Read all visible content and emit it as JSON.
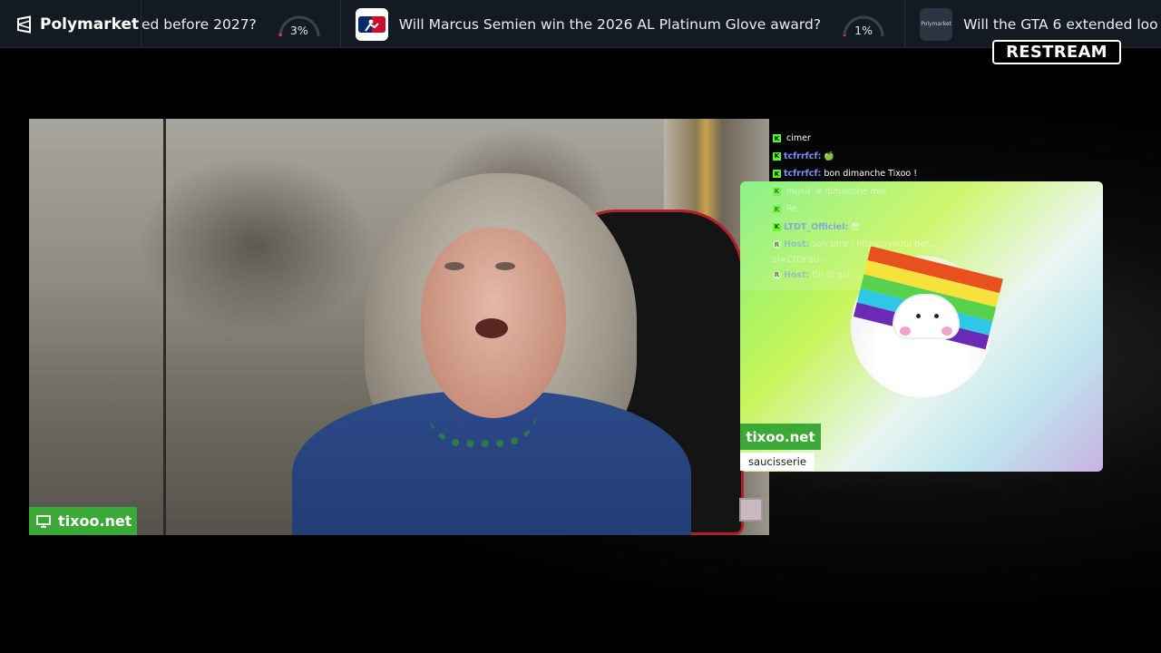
{
  "ticker": {
    "brand": "Polymarket",
    "markets": [
      {
        "question": "ed before 2027?",
        "percent_label": "3%",
        "percent": 3
      },
      {
        "question": "Will Marcus Semien win the 2026 AL Platinum Glove award?",
        "percent_label": "1%",
        "percent": 1
      },
      {
        "question": "Will the GTA 6 extended loo",
        "percent_label": "",
        "percent": null
      }
    ],
    "logo_labels": {
      "polymarket_small": "Polymarket"
    }
  },
  "restream": {
    "logo_text": "RESTREAM"
  },
  "camera": {
    "tag_label": "tixoo.net"
  },
  "chat": {
    "messages": [
      {
        "platform": "kick",
        "user": "",
        "text": "cimer"
      },
      {
        "platform": "kick",
        "user": "tcfrrfcf:",
        "text": "🍏"
      },
      {
        "platform": "kick",
        "user": "tcfrrfcf:",
        "text": "bon dimanche Tixoo !"
      },
      {
        "platform": "kick",
        "user": "",
        "text": "music le dimanche moi"
      },
      {
        "platform": "kick",
        "user": "",
        "text": "Re"
      },
      {
        "platform": "kick",
        "user": "LTDT_Officiel:",
        "text": "😳"
      },
      {
        "platform": "restream",
        "user": "Host:",
        "text": "son titre : https://youtu.be/..."
      },
      {
        "platform": "restream",
        "user": "",
        "text": "si=CtOPSu..."
      },
      {
        "platform": "restream",
        "user": "Host:",
        "text": "tin di gol ..."
      }
    ]
  },
  "overlay": {
    "tag_label": "tixoo.net",
    "sub_label": "saucisserie"
  },
  "colors": {
    "accent_green": "#3aa935",
    "kick_green": "#53fc18",
    "ticker_bg": "#141a22"
  }
}
